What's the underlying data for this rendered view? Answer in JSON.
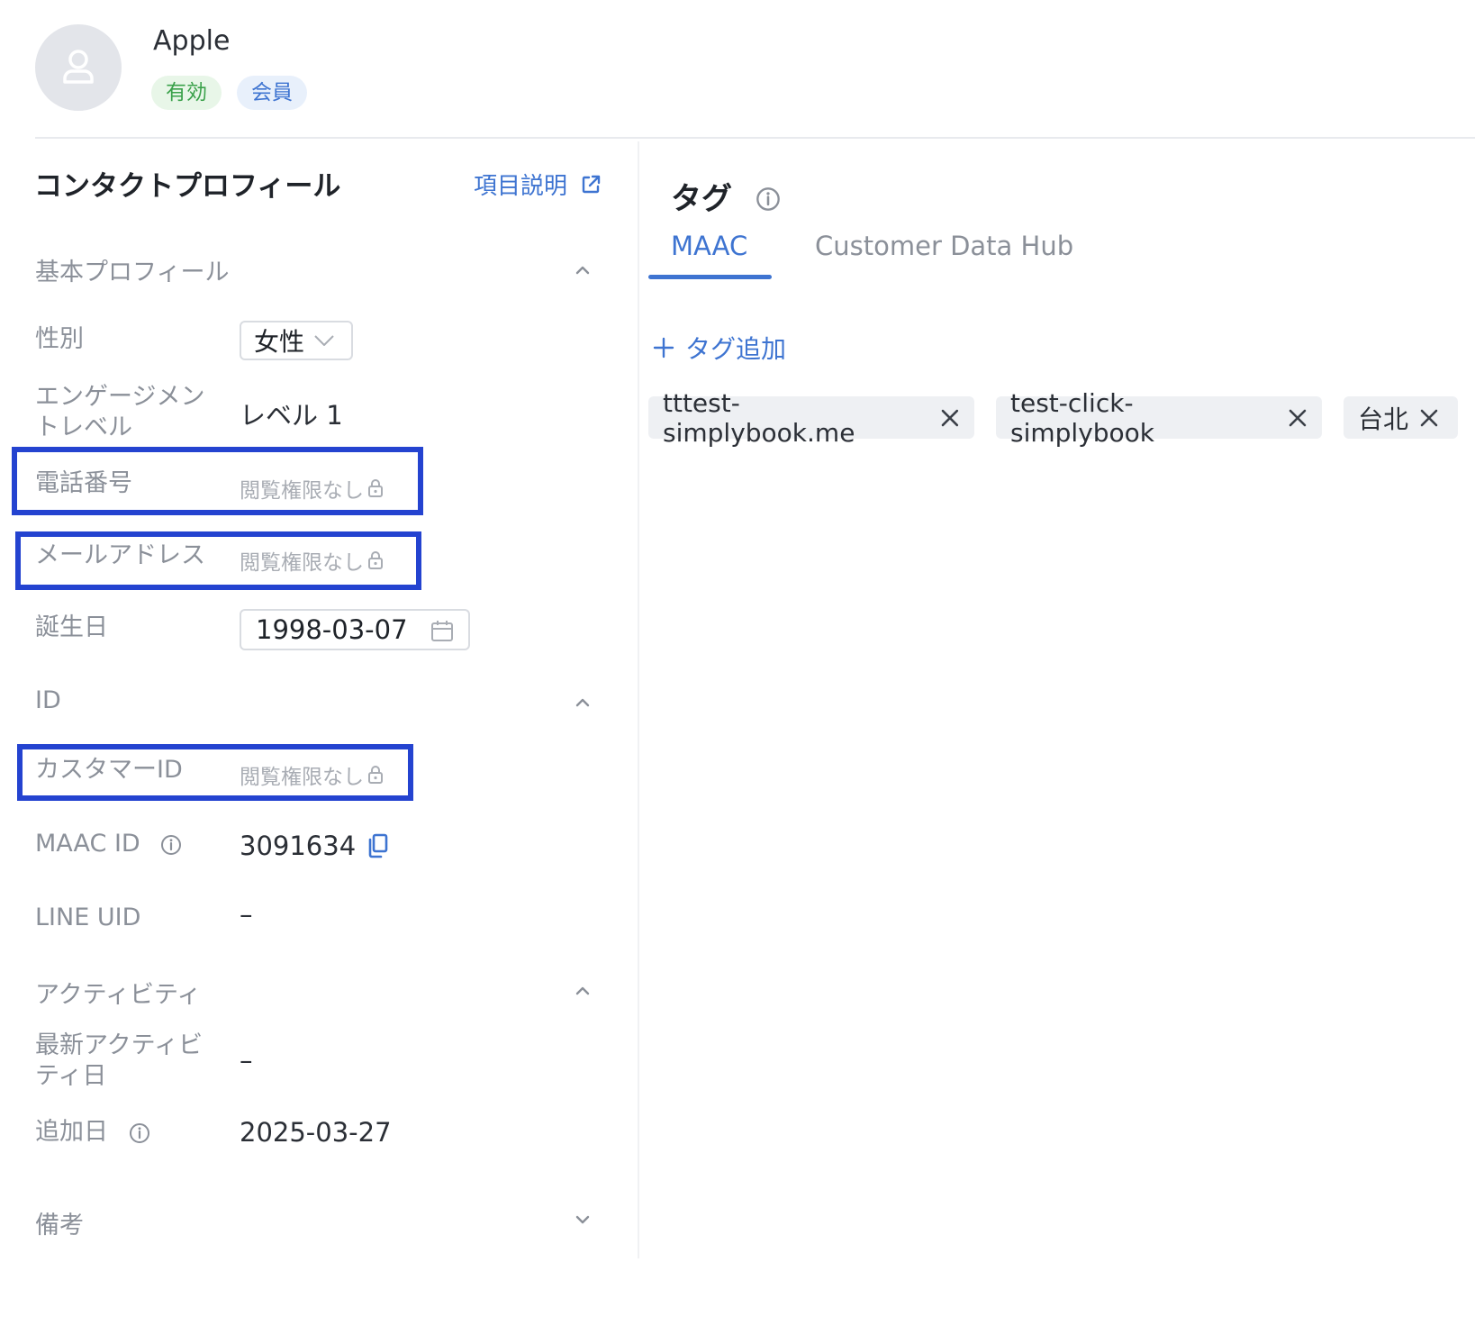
{
  "contact": {
    "name": "Apple",
    "badges": {
      "active": "有効",
      "member": "会員"
    }
  },
  "profile": {
    "title": "コンタクトプロフィール",
    "help_link": "項目説明",
    "sections": {
      "basic": "基本プロフィール",
      "id": "ID",
      "activity": "アクティビティ",
      "notes": "備考"
    },
    "fields": {
      "gender": {
        "label": "性別",
        "value": "女性"
      },
      "engagement": {
        "label_line1": "エンゲージメン",
        "label_line2": "トレベル",
        "value": "レベル 1"
      },
      "phone": {
        "label": "電話番号",
        "value": "閲覧権限なし"
      },
      "email": {
        "label": "メールアドレス",
        "value": "閲覧権限なし"
      },
      "birthday": {
        "label": "誕生日",
        "value": "1998-03-07"
      },
      "customer_id": {
        "label": "カスタマーID",
        "value": "閲覧権限なし"
      },
      "maac_id": {
        "label": "MAAC ID",
        "value": "3091634"
      },
      "line_uid": {
        "label": "LINE UID",
        "value": "–"
      },
      "last_activity": {
        "label_line1": "最新アクティビ",
        "label_line2": "ティ日",
        "value": "–"
      },
      "added_date": {
        "label": "追加日",
        "value": "2025-03-27"
      }
    }
  },
  "tags": {
    "title": "タグ",
    "tabs": [
      "MAAC",
      "Customer Data Hub"
    ],
    "active_tab": "MAAC",
    "add_label": "タグ追加",
    "items": [
      "tttest-simplybook.me",
      "test-click-simplybook",
      "台北"
    ]
  },
  "colors": {
    "accent": "#3e74d1",
    "highlight_box": "#2443d0",
    "active_badge_bg": "#e8f6e8",
    "active_badge_text": "#3aa14a",
    "member_badge_bg": "#e8f0fb"
  },
  "icons": [
    "user-icon",
    "external-link-icon",
    "chevron-up-icon",
    "chevron-down-icon",
    "lock-icon",
    "calendar-icon",
    "info-icon",
    "copy-icon",
    "plus-icon",
    "close-icon"
  ]
}
